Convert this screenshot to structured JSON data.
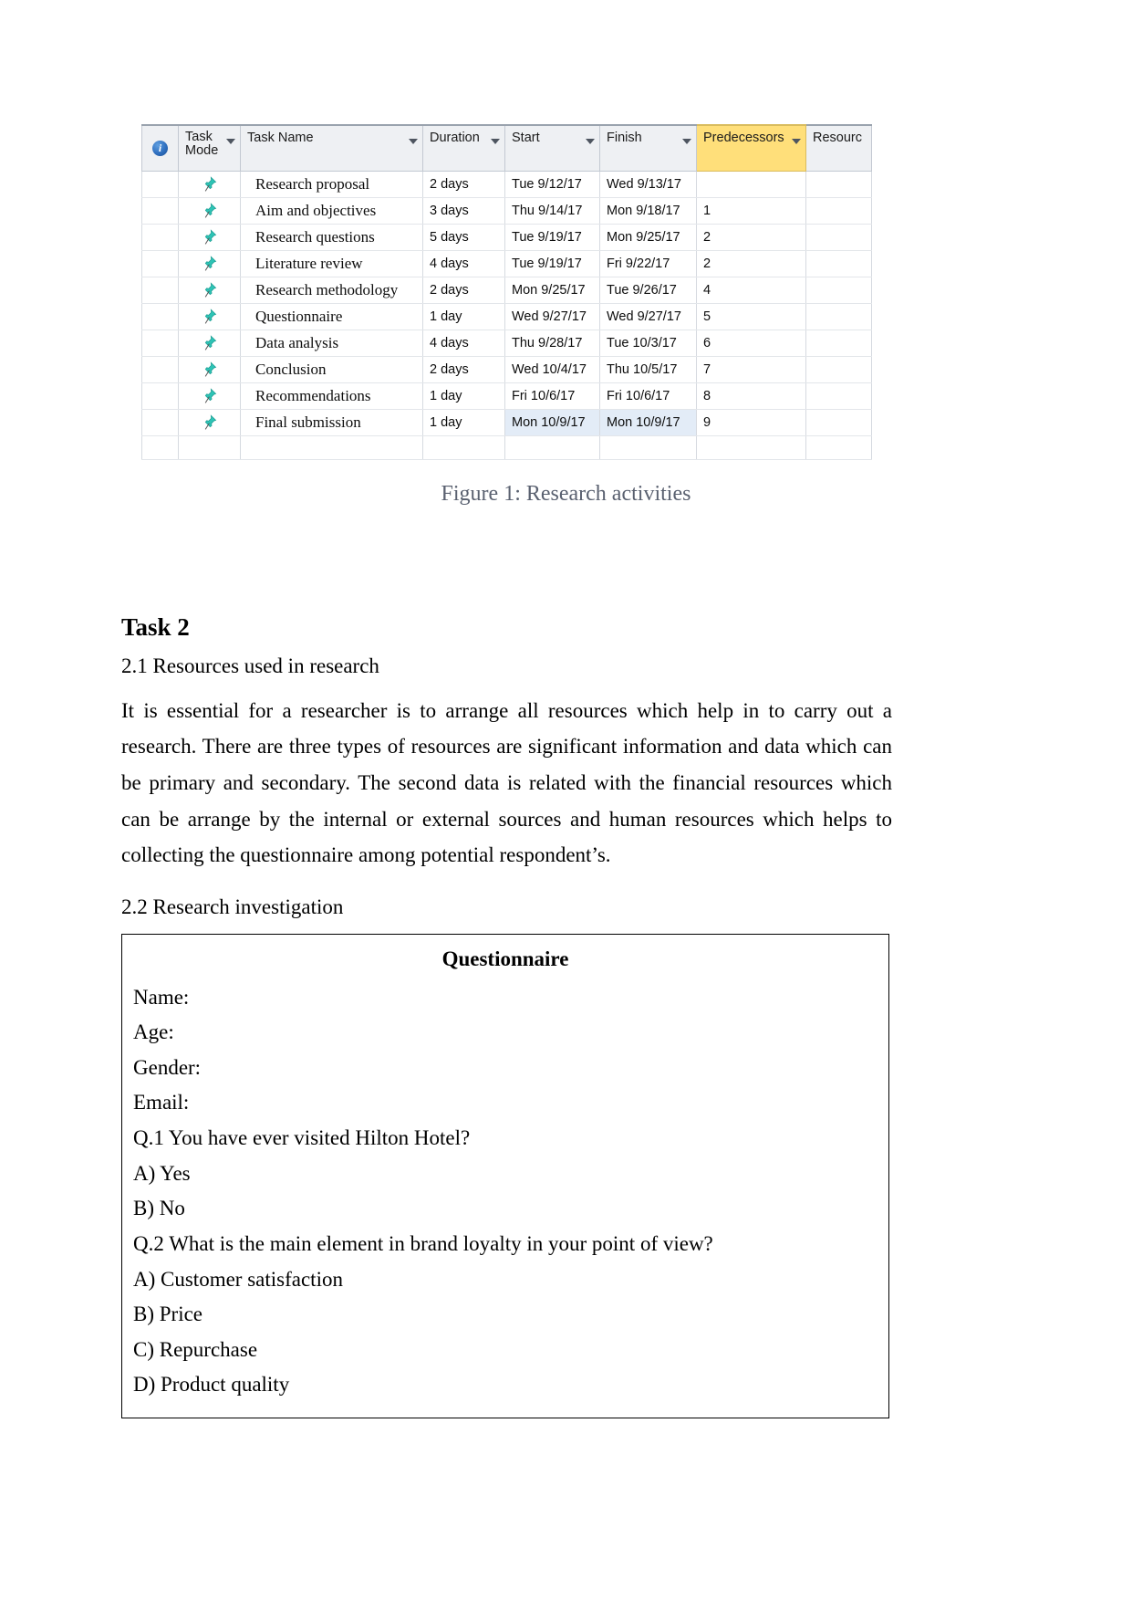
{
  "figure": {
    "caption": "Figure 1: Research activities",
    "info_icon_glyph": "i",
    "table": {
      "headers": [
        {
          "label": "",
          "name": "info-column-header"
        },
        {
          "label": "Task Mode",
          "name": "task-mode-column-header"
        },
        {
          "label": "Task Name",
          "name": "task-name-column-header"
        },
        {
          "label": "Duration",
          "name": "duration-column-header"
        },
        {
          "label": "Start",
          "name": "start-column-header"
        },
        {
          "label": "Finish",
          "name": "finish-column-header"
        },
        {
          "label": "Predecessors",
          "name": "predecessors-column-header"
        },
        {
          "label": "Resourc",
          "name": "resource-names-column-header"
        }
      ],
      "header_highlight_color": "#ffdf7a",
      "selection_color": "#e3ecf7",
      "rows": [
        {
          "task_name": "Research proposal",
          "duration": "2 days",
          "start": "Tue 9/12/17",
          "finish": "Wed 9/13/17",
          "predecessors": "",
          "resource": ""
        },
        {
          "task_name": "Aim and objectives",
          "duration": "3 days",
          "start": "Thu 9/14/17",
          "finish": "Mon 9/18/17",
          "predecessors": "1",
          "resource": ""
        },
        {
          "task_name": "Research questions",
          "duration": "5 days",
          "start": "Tue 9/19/17",
          "finish": "Mon 9/25/17",
          "predecessors": "2",
          "resource": ""
        },
        {
          "task_name": "Literature review",
          "duration": "4 days",
          "start": "Tue 9/19/17",
          "finish": "Fri 9/22/17",
          "predecessors": "2",
          "resource": ""
        },
        {
          "task_name": "Research methodology",
          "duration": "2 days",
          "start": "Mon 9/25/17",
          "finish": "Tue 9/26/17",
          "predecessors": "4",
          "resource": ""
        },
        {
          "task_name": "Questionnaire",
          "duration": "1 day",
          "start": "Wed 9/27/17",
          "finish": "Wed 9/27/17",
          "predecessors": "5",
          "resource": ""
        },
        {
          "task_name": "Data analysis",
          "duration": "4 days",
          "start": "Thu 9/28/17",
          "finish": "Tue 10/3/17",
          "predecessors": "6",
          "resource": ""
        },
        {
          "task_name": "Conclusion",
          "duration": "2 days",
          "start": "Wed 10/4/17",
          "finish": "Thu 10/5/17",
          "predecessors": "7",
          "resource": ""
        },
        {
          "task_name": "Recommendations",
          "duration": "1 day",
          "start": "Fri 10/6/17",
          "finish": "Fri 10/6/17",
          "predecessors": "8",
          "resource": ""
        },
        {
          "task_name": "Final submission",
          "duration": "1 day",
          "start": "Mon 10/9/17",
          "finish": "Mon 10/9/17",
          "predecessors": "9",
          "resource": "",
          "selected": true
        }
      ]
    }
  },
  "task2": {
    "heading": "Task 2",
    "section_2_1_heading": "2.1 Resources used in research",
    "paragraph_2_1": "It is essential for a researcher is to arrange all resources which help in to carry out a research. There are three types of resources are significant information and data which can be primary and secondary. The second data is related with the financial resources which can be arrange by the internal or external sources and human resources which helps to collecting the questionnaire among potential respondent’s.",
    "section_2_2_heading": "2.2 Research investigation"
  },
  "questionnaire": {
    "title": "Questionnaire",
    "lines": [
      "Name:",
      "Age:",
      "Gender:",
      "Email:",
      "Q.1 You have ever visited Hilton Hotel?",
      "A) Yes",
      "B) No",
      "Q.2 What is the main element in brand loyalty in your point of view?",
      "A) Customer satisfaction",
      "B) Price",
      "C) Repurchase",
      "D) Product quality"
    ]
  }
}
